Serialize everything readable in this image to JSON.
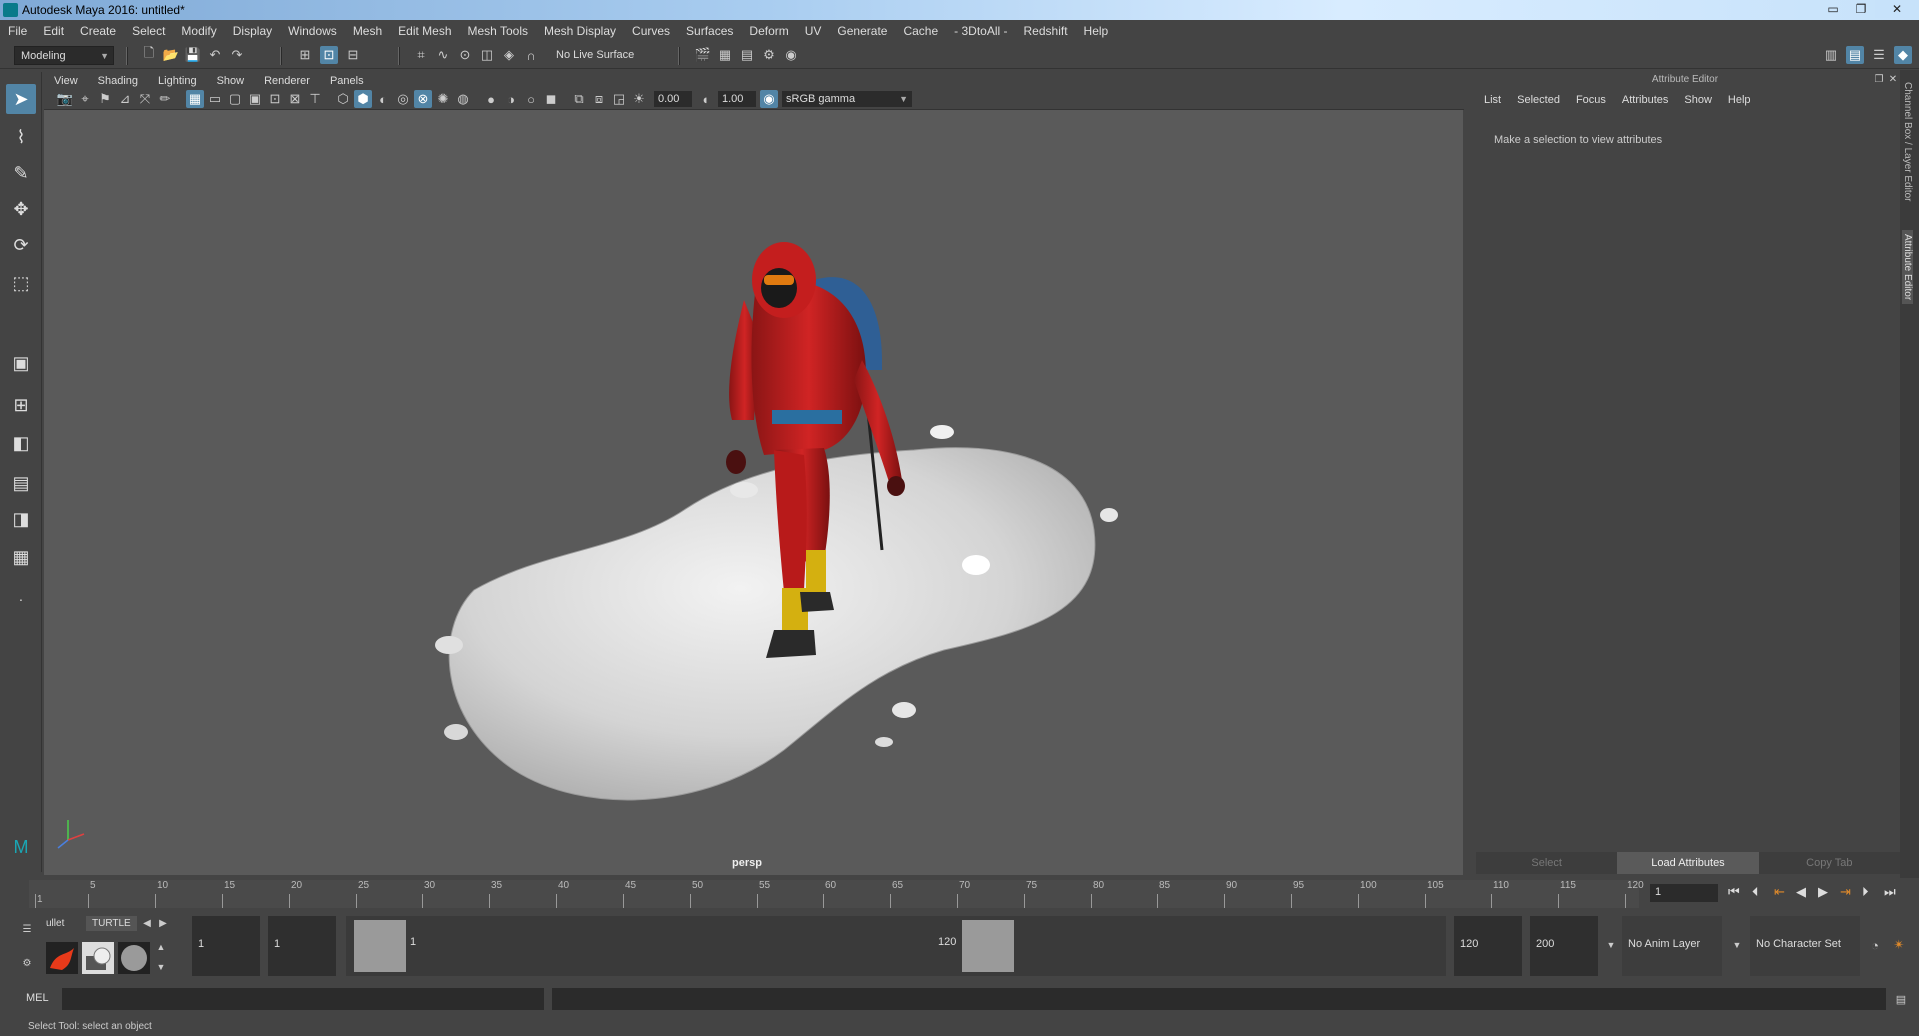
{
  "window": {
    "title": "Autodesk Maya 2016: untitled*",
    "min": "▭",
    "max": "❐",
    "close": "✕"
  },
  "menu": [
    "File",
    "Edit",
    "Create",
    "Select",
    "Modify",
    "Display",
    "Windows",
    "Mesh",
    "Edit Mesh",
    "Mesh Tools",
    "Mesh Display",
    "Curves",
    "Surfaces",
    "Deform",
    "UV",
    "Generate",
    "Cache",
    "- 3DtoAll -",
    "Redshift",
    "Help"
  ],
  "shelf": {
    "mode": "Modeling",
    "live_surface": "No Live Surface"
  },
  "panel_menu": [
    "View",
    "Shading",
    "Lighting",
    "Show",
    "Renderer",
    "Panels"
  ],
  "panel_tools": {
    "exposure": "0.00",
    "gamma": "1.00",
    "color_space": "sRGB gamma"
  },
  "viewport": {
    "camera": "persp"
  },
  "attribute_editor": {
    "header": "Attribute Editor",
    "menu": [
      "List",
      "Selected",
      "Focus",
      "Attributes",
      "Show",
      "Help"
    ],
    "hint": "Make a selection to view attributes",
    "buttons": {
      "select": "Select",
      "load": "Load Attributes",
      "copy": "Copy Tab"
    }
  },
  "side_tabs": {
    "channel": "Channel Box / Layer Editor",
    "attr": "Attribute Editor"
  },
  "timeline": {
    "ticks": [
      "1",
      "5",
      "10",
      "15",
      "20",
      "25",
      "30",
      "35",
      "40",
      "45",
      "50",
      "55",
      "60",
      "65",
      "70",
      "75",
      "80",
      "85",
      "90",
      "95",
      "100",
      "105",
      "110",
      "115",
      "120"
    ],
    "current_frame": "1"
  },
  "range": {
    "shelf_tabs": [
      "ullet",
      "TURTLE"
    ],
    "start": "1",
    "playback_start": "1",
    "slider_start": "1",
    "slider_end": "120",
    "playback_end": "120",
    "end": "200",
    "anim_layer": "No Anim Layer",
    "char_set": "No Character Set"
  },
  "cmd": {
    "lang": "MEL"
  },
  "status": {
    "help": "Select Tool: select an object"
  },
  "colors": {
    "accent": "#5285a6",
    "background": "#444444",
    "viewport": "#5a5a5a"
  }
}
